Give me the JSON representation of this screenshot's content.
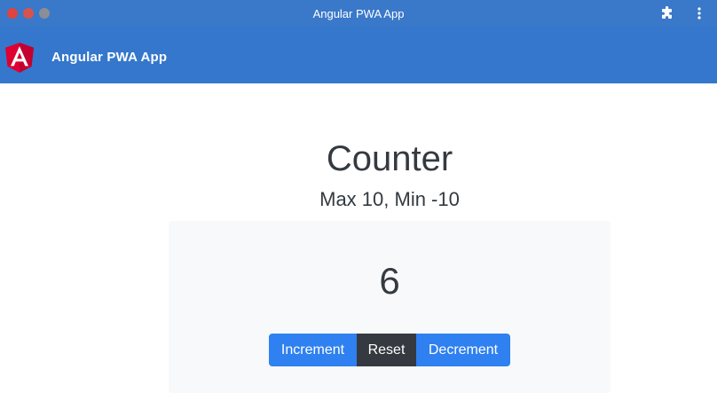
{
  "window": {
    "title": "Angular PWA App",
    "controls": [
      "close",
      "minimize",
      "zoom"
    ],
    "extension_icon": "puzzle-icon",
    "menu_icon": "vertical-ellipsis-icon"
  },
  "header": {
    "logo_icon": "angular-logo-icon",
    "app_name": "Angular PWA App",
    "background": "#3477cc"
  },
  "main": {
    "title": "Counter",
    "subtitle": "Max 10, Min -10",
    "count": "6",
    "buttons": {
      "increment": "Increment",
      "reset": "Reset",
      "decrement": "Decrement"
    }
  },
  "colors": {
    "primary": "#2f80f0",
    "dark": "#343a40",
    "panel": "#f8f9fa"
  }
}
